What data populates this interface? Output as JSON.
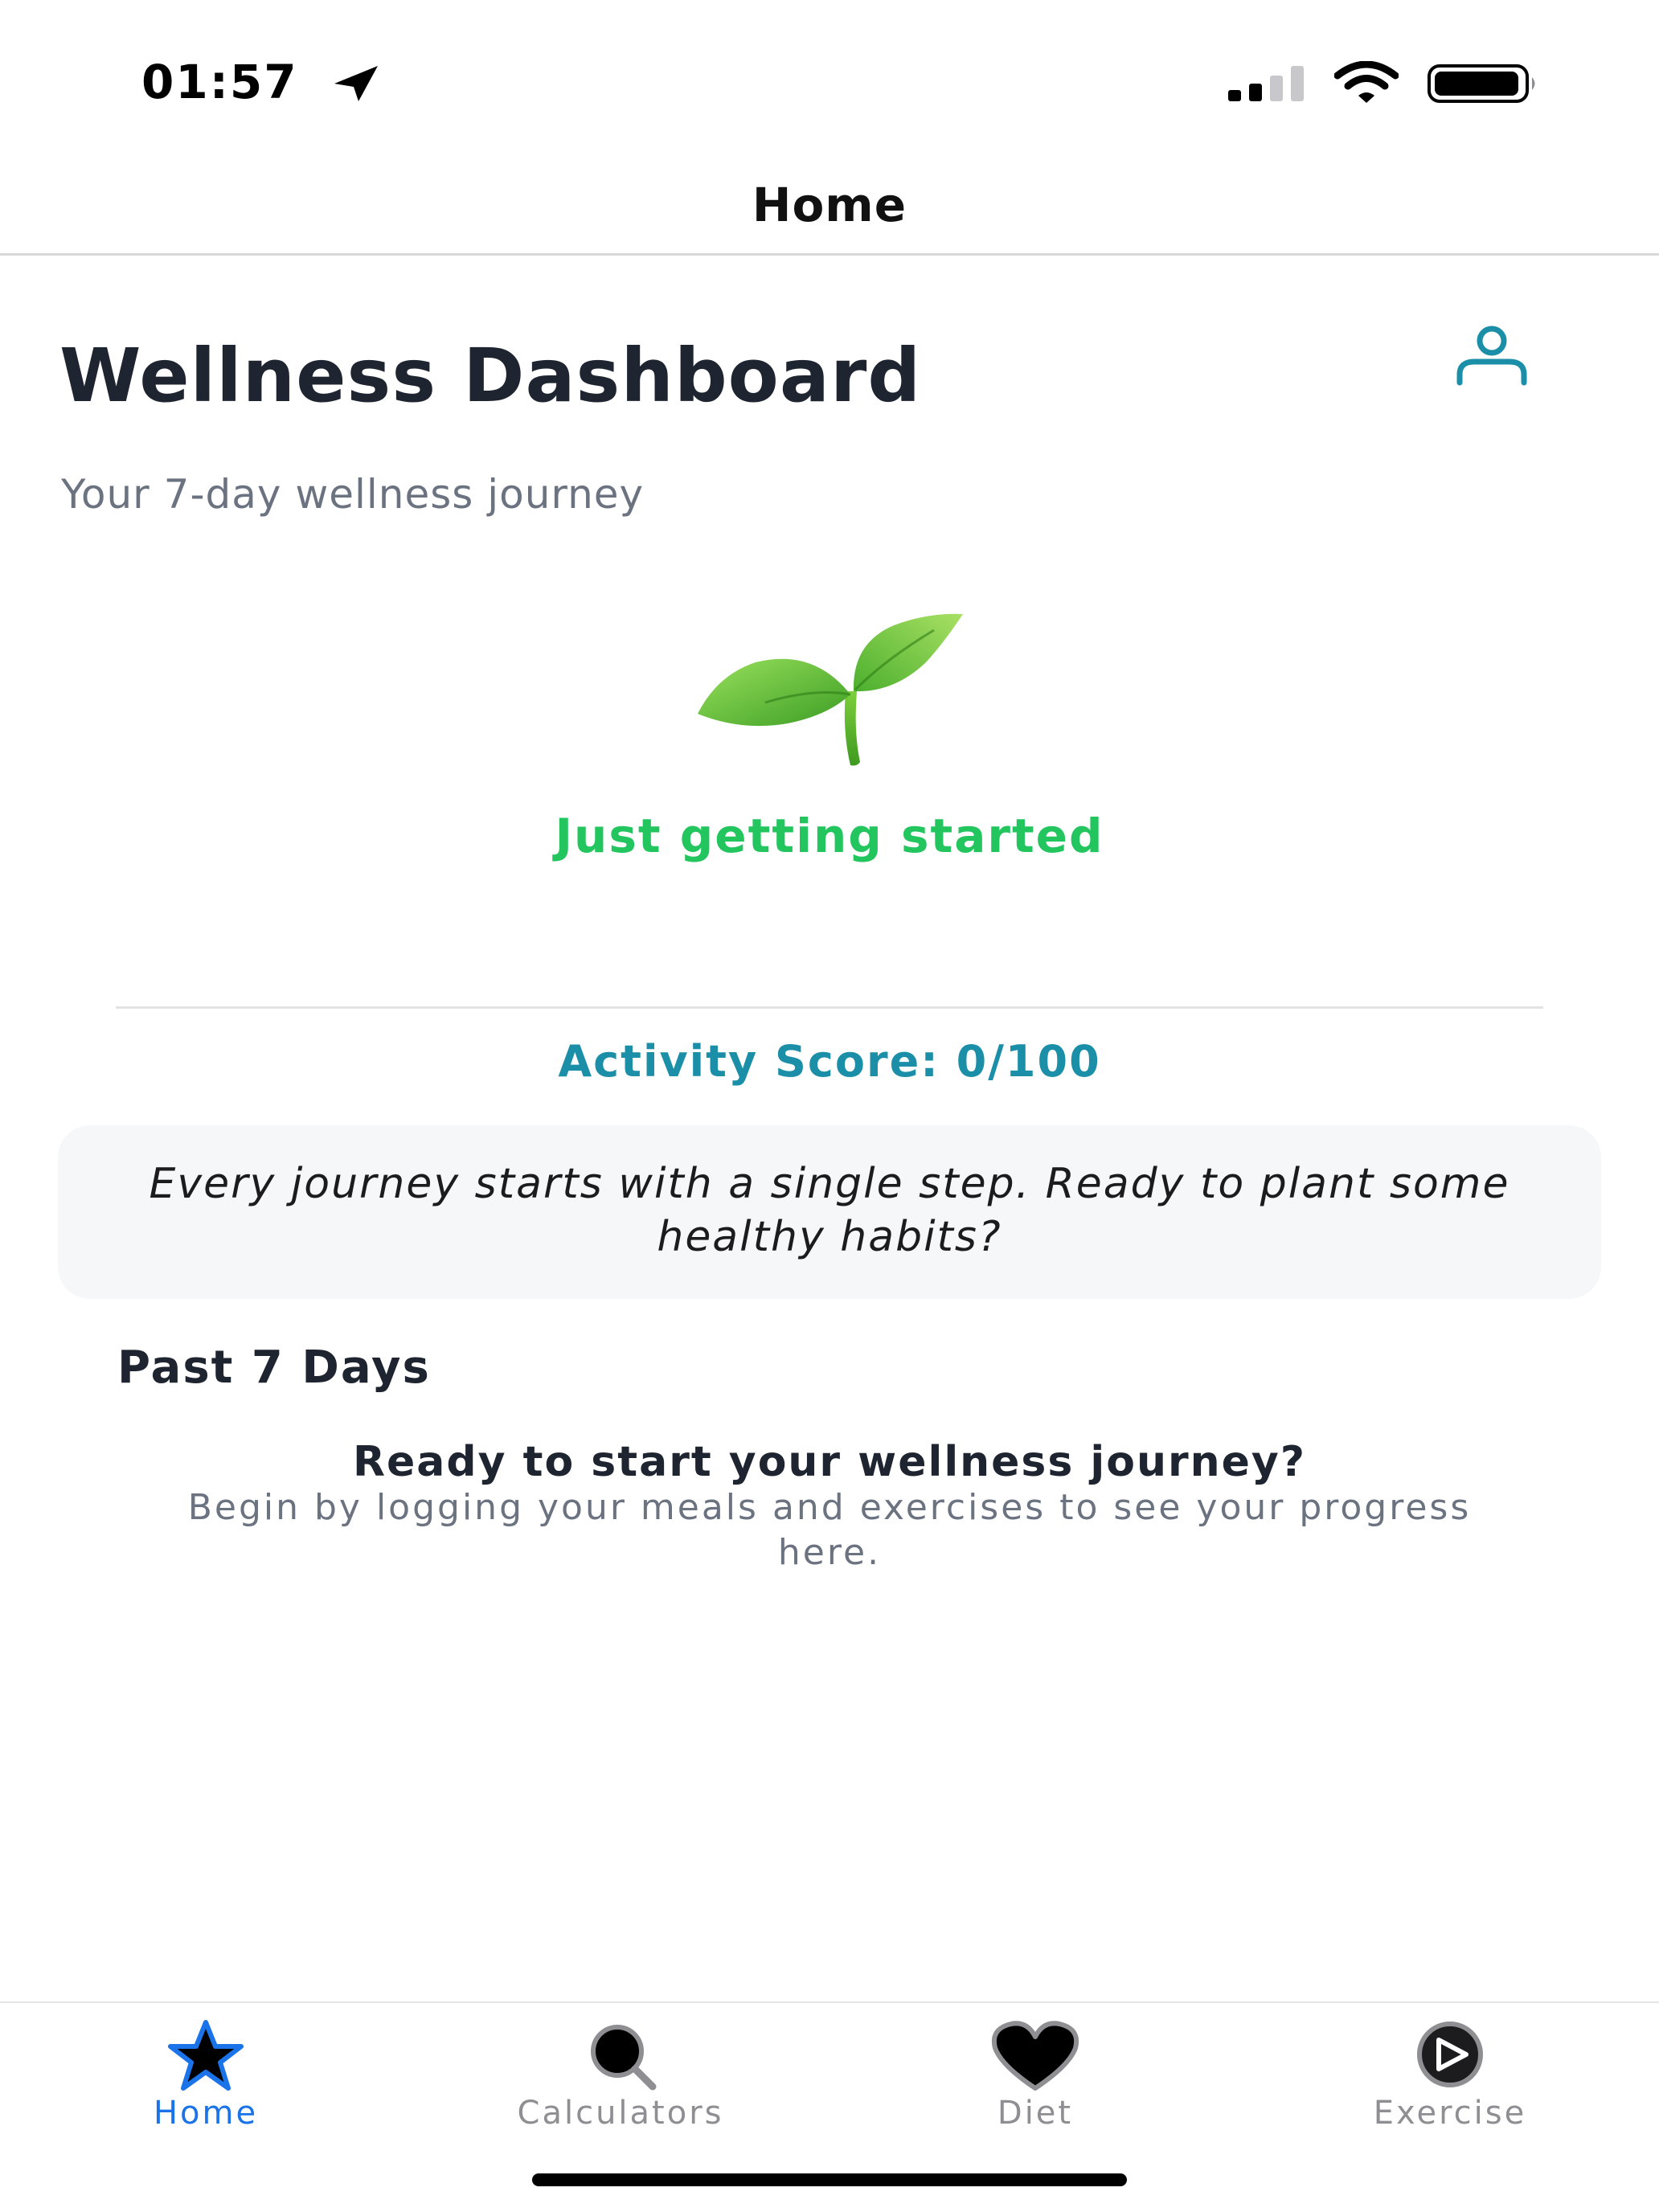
{
  "status_bar": {
    "time": "01:57"
  },
  "nav": {
    "title": "Home"
  },
  "dashboard": {
    "title": "Wellness Dashboard",
    "subtitle": "Your 7-day wellness journey",
    "status": "Just getting started",
    "activity_score": "Activity Score: 0/100",
    "quote": "Every journey starts with a single step. Ready to plant some healthy habits?"
  },
  "history": {
    "title": "Past 7 Days",
    "empty_title": "Ready to start your wellness journey?",
    "empty_text": "Begin by logging your meals and exercises to see your progress here."
  },
  "tabs": [
    {
      "label": "Home",
      "icon": "star-icon",
      "active": true
    },
    {
      "label": "Calculators",
      "icon": "search-icon",
      "active": false
    },
    {
      "label": "Diet",
      "icon": "heart-icon",
      "active": false
    },
    {
      "label": "Exercise",
      "icon": "play-circle-icon",
      "active": false
    }
  ],
  "colors": {
    "accent": "#1a73e8",
    "status_green": "#22c55e",
    "score_teal": "#1b8ea8",
    "inactive_tab": "#8e8e93"
  }
}
